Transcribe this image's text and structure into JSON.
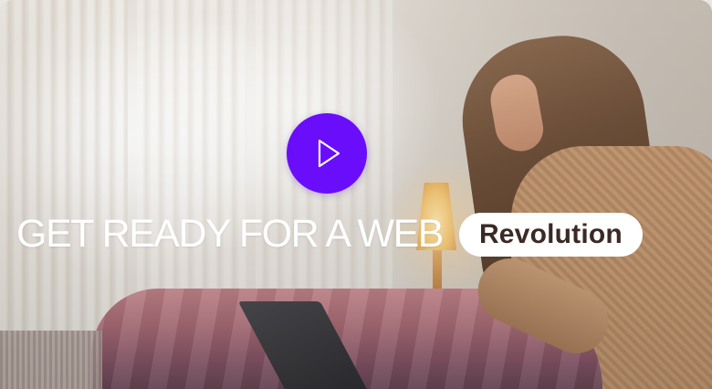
{
  "hero": {
    "headline": "GET READY FOR A WEB",
    "highlight": "Revolution",
    "play_icon": "play-icon",
    "play_color": "#6a0dfb"
  }
}
